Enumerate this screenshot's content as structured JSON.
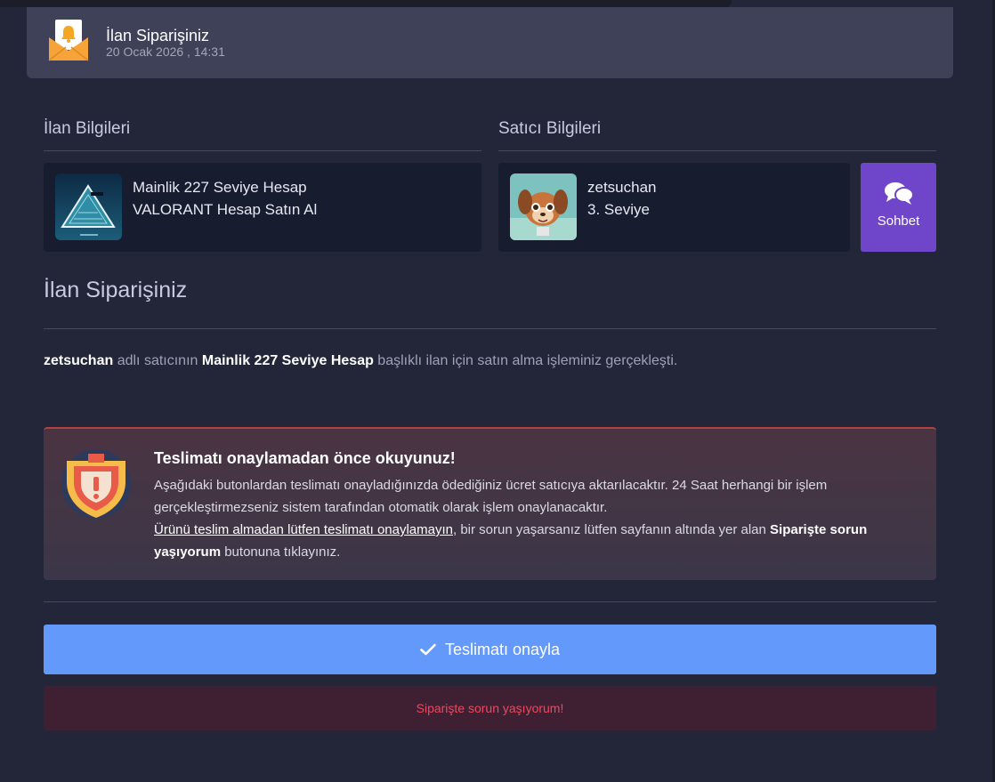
{
  "header": {
    "title": "İlan Siparişiniz",
    "date": "20 Ocak 2026 , 14:31"
  },
  "listing_section": {
    "title": "İlan Bilgileri",
    "product_name": "Mainlik 227 Seviye Hesap",
    "product_category": "VALORANT Hesap Satın Al"
  },
  "seller_section": {
    "title": "Satıcı Bilgileri",
    "seller_name": "zetsuchan",
    "seller_level": "3. Seviye",
    "chat_label": "Sohbet"
  },
  "order": {
    "title": "İlan Siparişiniz",
    "desc_seller": "zetsuchan",
    "desc_part1": " adlı satıcının ",
    "desc_product": "Mainlik 227 Seviye Hesap",
    "desc_part2": " başlıklı ilan için satın alma işleminiz gerçekleşti."
  },
  "warning": {
    "title": "Teslimatı onaylamadan önce okuyunuz!",
    "text1": "Aşağıdaki butonlardan teslimatı onayladığınızda ödediğiniz ücret satıcıya aktarılacaktır. 24 Saat herhangi bir işlem gerçekleştirmezseniz sistem tarafından otomatik olarak işlem onaylanacaktır.",
    "underline": "Ürünü teslim almadan lütfen teslimatı onaylamayın",
    "text2": ", bir sorun yaşarsanız lütfen sayfanın altında yer alan ",
    "bold": "Siparişte sorun yaşıyorum",
    "text3": " butonuna tıklayınız."
  },
  "buttons": {
    "confirm": "Teslimatı onayla",
    "problem": "Siparişte sorun yaşıyorum!"
  },
  "icons": {
    "header": "mail-bell-icon",
    "warning": "shield-warning-icon",
    "chat": "chat-bubbles-icon",
    "check": "check-icon"
  },
  "colors": {
    "background": "#232638",
    "confirm": "#6399fb",
    "chat": "#6f45c9",
    "problem_text": "#f0475f"
  }
}
